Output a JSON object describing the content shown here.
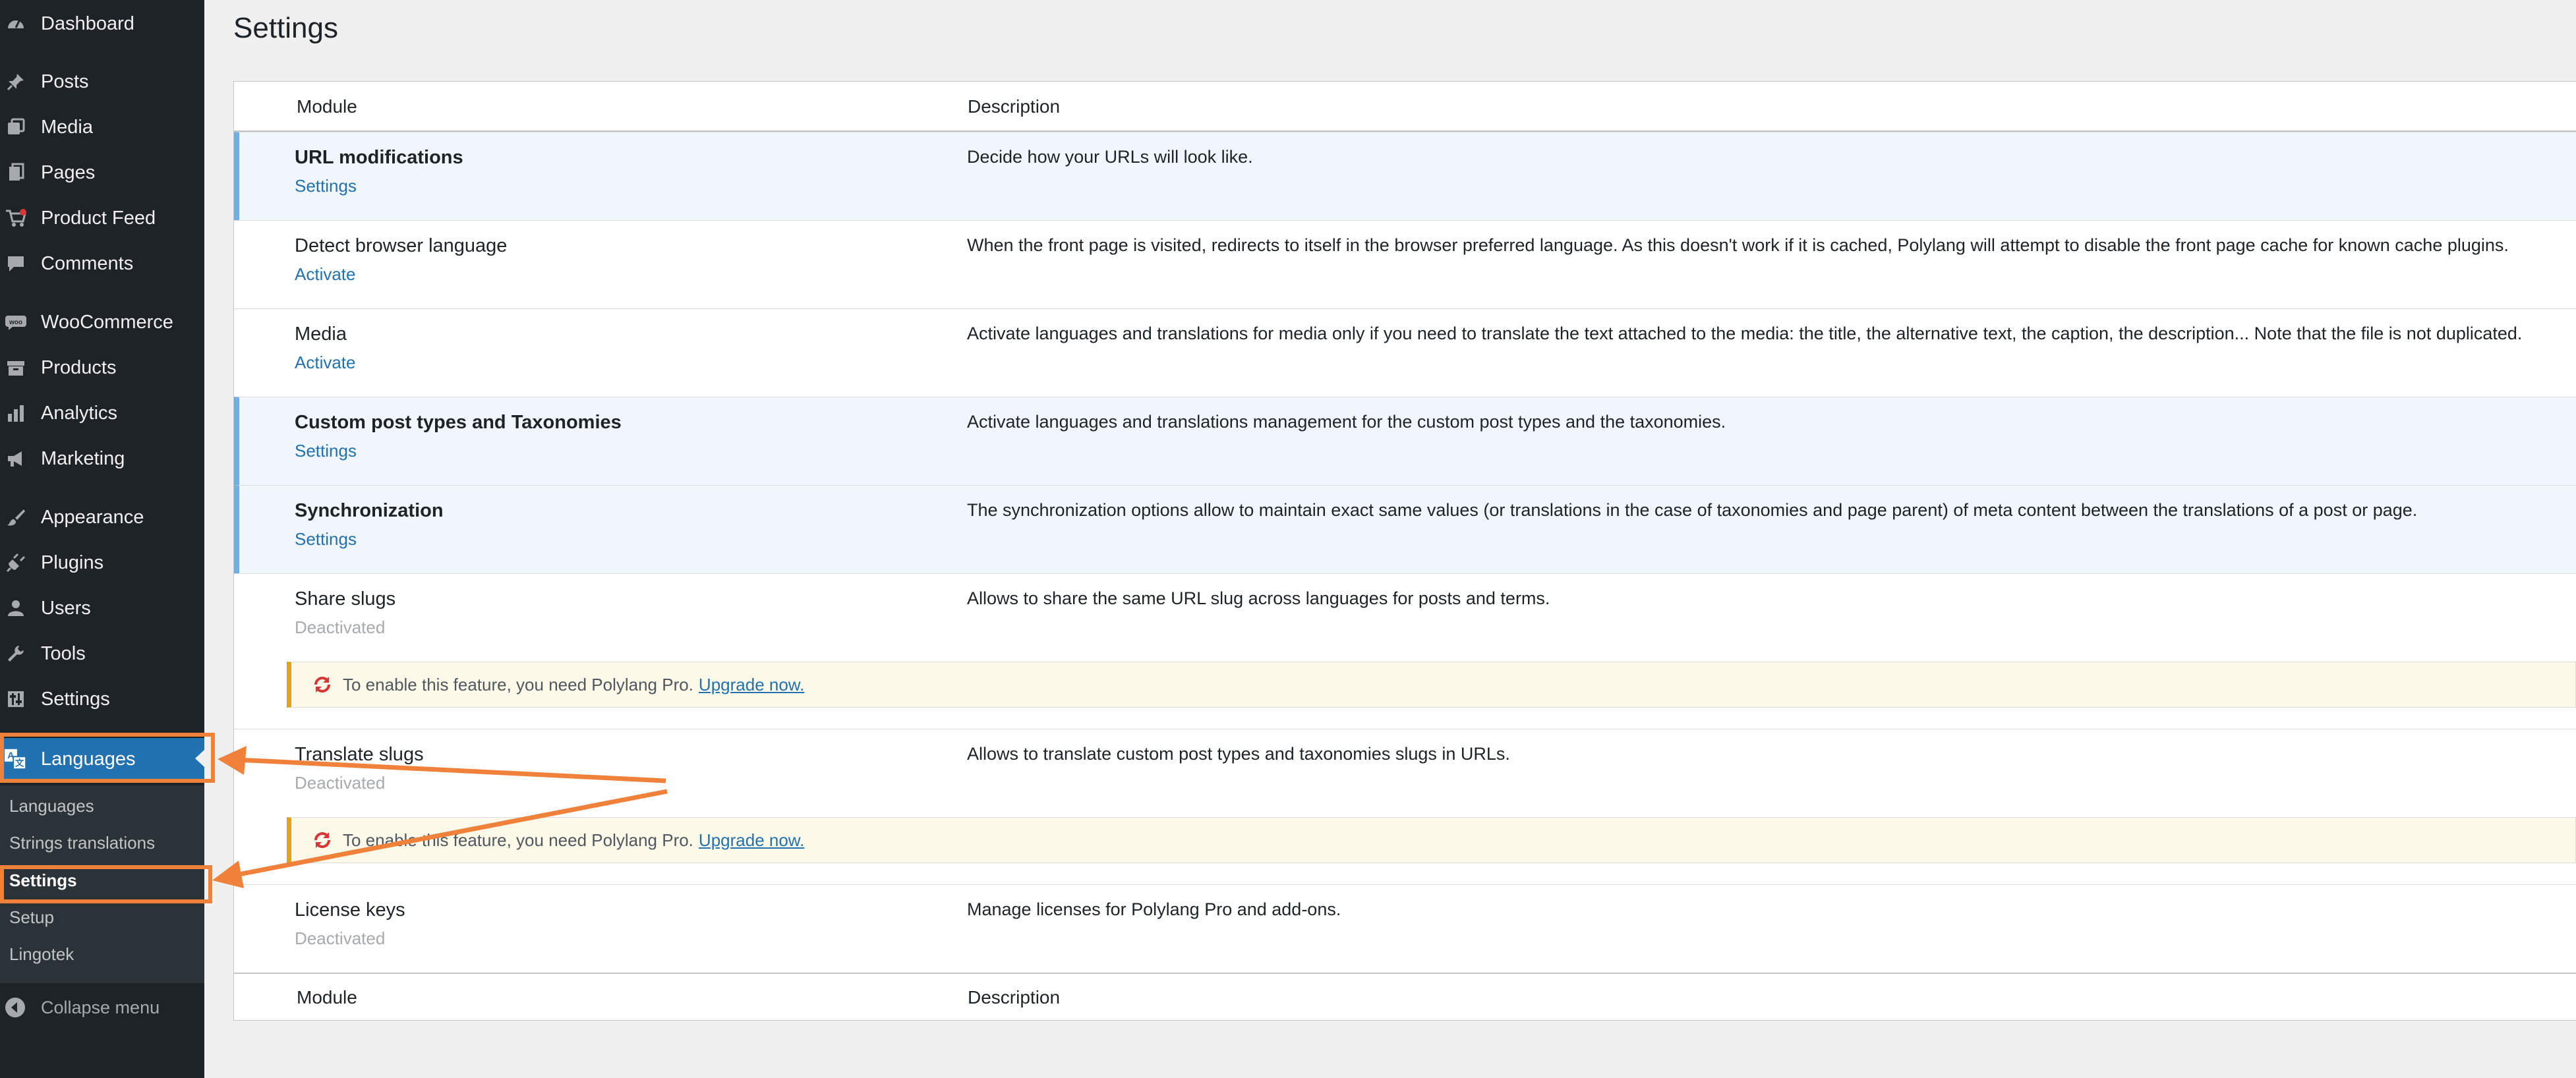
{
  "sidebar": {
    "items": [
      {
        "label": "Dashboard",
        "icon": "dashboard-icon"
      },
      {
        "label": "Posts",
        "icon": "pushpin-icon"
      },
      {
        "label": "Media",
        "icon": "media-icon"
      },
      {
        "label": "Pages",
        "icon": "pages-icon"
      },
      {
        "label": "Product Feed",
        "icon": "cart-icon"
      },
      {
        "label": "Comments",
        "icon": "comment-icon"
      },
      {
        "label": "WooCommerce",
        "icon": "woocommerce-icon"
      },
      {
        "label": "Products",
        "icon": "archive-icon"
      },
      {
        "label": "Analytics",
        "icon": "bar-chart-icon"
      },
      {
        "label": "Marketing",
        "icon": "megaphone-icon"
      },
      {
        "label": "Appearance",
        "icon": "paintbrush-icon"
      },
      {
        "label": "Plugins",
        "icon": "plug-icon"
      },
      {
        "label": "Users",
        "icon": "user-icon"
      },
      {
        "label": "Tools",
        "icon": "wrench-icon"
      },
      {
        "label": "Settings",
        "icon": "sliders-icon"
      },
      {
        "label": "Languages",
        "icon": "translation-icon"
      }
    ],
    "submenu": [
      "Languages",
      "Strings translations",
      "Settings",
      "Setup",
      "Lingotek"
    ],
    "collapse_label": "Collapse menu"
  },
  "page": {
    "title": "Settings"
  },
  "table": {
    "header_module": "Module",
    "header_description": "Description",
    "footer_module": "Module",
    "footer_description": "Description",
    "rows": [
      {
        "name": "URL modifications",
        "action": "Settings",
        "description": "Decide how your URLs will look like."
      },
      {
        "name": "Detect browser language",
        "action": "Activate",
        "description": "When the front page is visited, redirects to itself in the browser preferred language. As this doesn't work if it is cached, Polylang will attempt to disable the front page cache for known cache plugins."
      },
      {
        "name": "Media",
        "action": "Activate",
        "description": "Activate languages and translations for media only if you need to translate the text attached to the media: the title, the alternative text, the caption, the description... Note that the file is not duplicated."
      },
      {
        "name": "Custom post types and Taxonomies",
        "action": "Settings",
        "description": "Activate languages and translations management for the custom post types and the taxonomies."
      },
      {
        "name": "Synchronization",
        "action": "Settings",
        "description": "The synchronization options allow to maintain exact same values (or translations in the case of taxonomies and page parent) of meta content between the translations of a post or page."
      },
      {
        "name": "Share slugs",
        "action": "Deactivated",
        "description": "Allows to share the same URL slug across languages for posts and terms."
      },
      {
        "name": "Translate slugs",
        "action": "Deactivated",
        "description": "Allows to translate custom post types and taxonomies slugs in URLs."
      },
      {
        "name": "License keys",
        "action": "Deactivated",
        "description": "Manage licenses for Polylang Pro and add-ons."
      }
    ],
    "notices": [
      {
        "text": "To enable this feature, you need Polylang Pro.",
        "link": "Upgrade now."
      },
      {
        "text": "To enable this feature, you need Polylang Pro.",
        "link": "Upgrade now."
      }
    ]
  },
  "colors": {
    "sidebar_bg": "#1d2327",
    "accent": "#2271b1",
    "active_row_bg": "#f0f6fc",
    "active_row_border": "#72aee6",
    "notice_bg": "#fcf9e8",
    "notice_border": "#dba617",
    "annotation": "#f0813a"
  }
}
